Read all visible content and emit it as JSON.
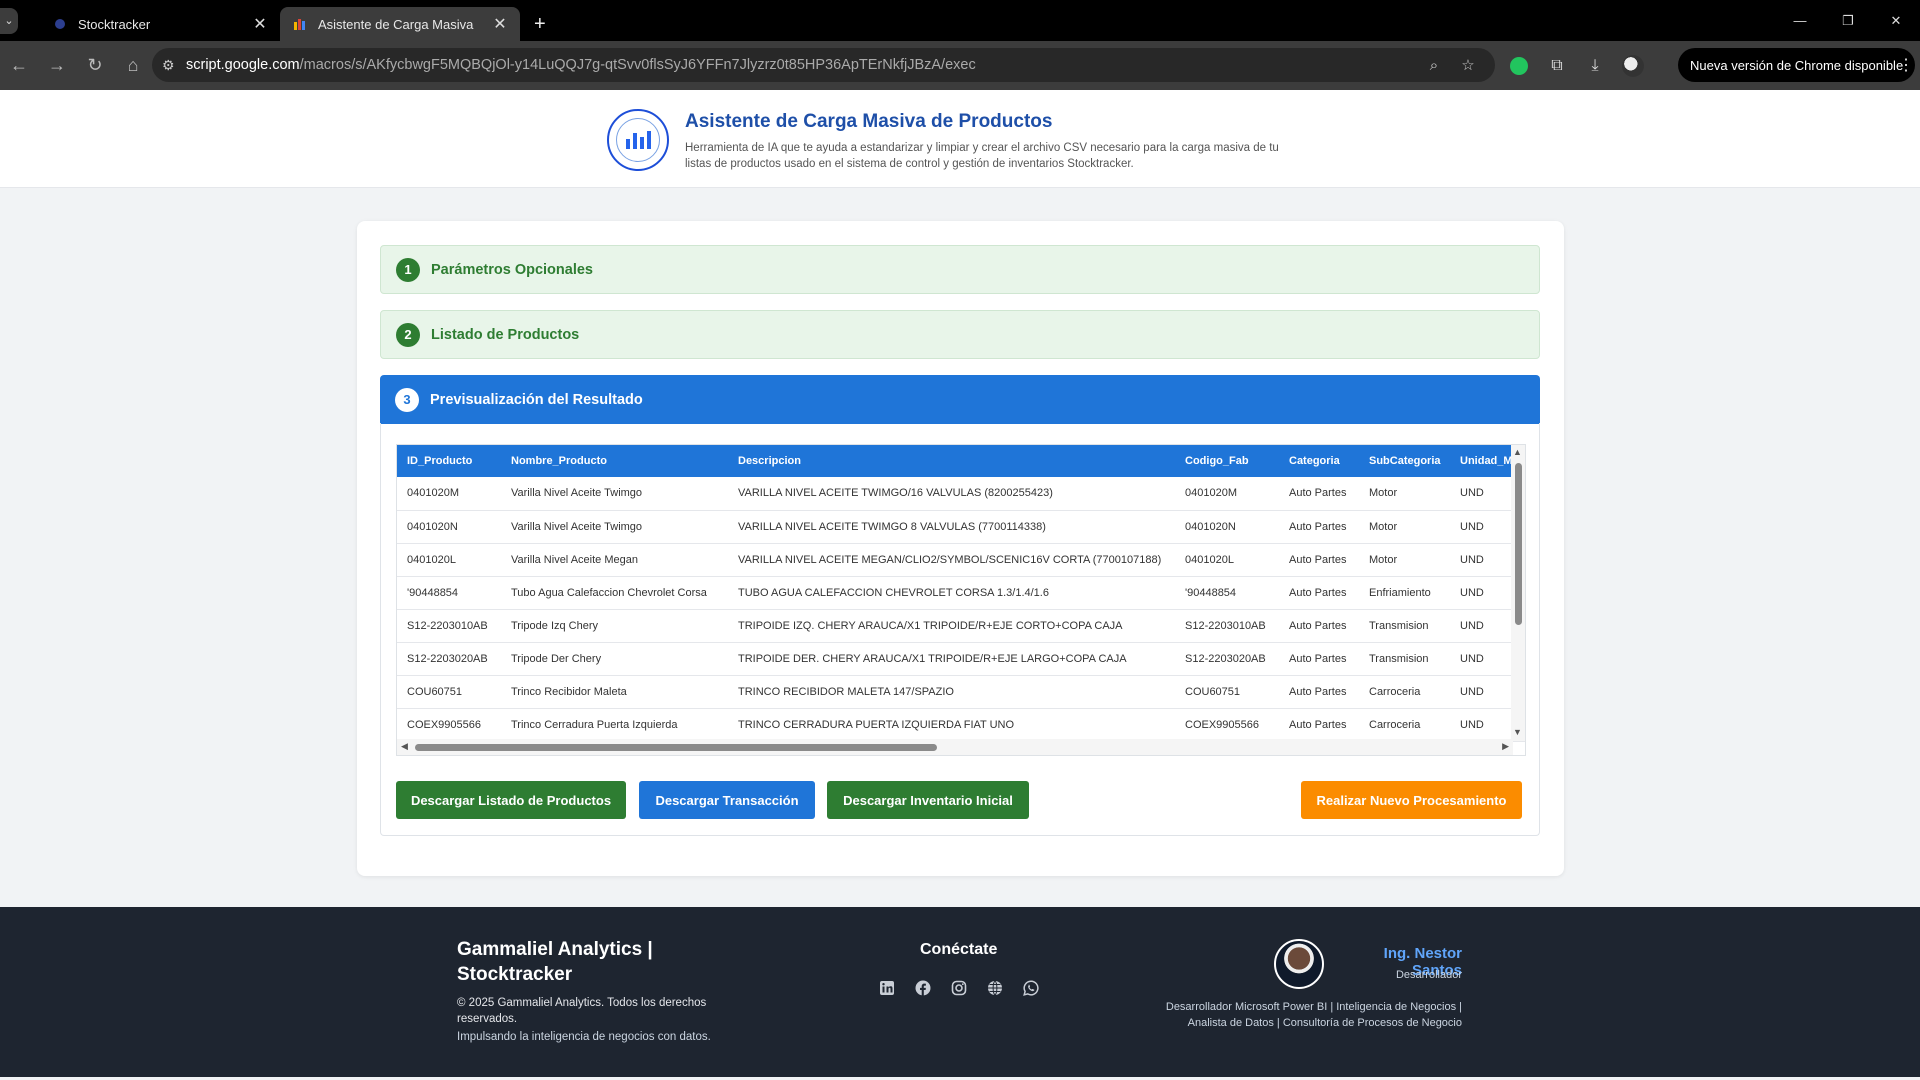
{
  "browser": {
    "tabs": [
      {
        "title": "Stocktracker"
      },
      {
        "title": "Asistente de Carga Masiva"
      }
    ],
    "url_host": "script.google.com",
    "url_path": "/macros/s/AKfycbwgF5MQBQjOl-y14LuQQJ7g-qtSvv0flsSyJ6YFFn7Jlyzrz0t85HP36ApTErNkfjJBzA/exec",
    "update_label": "Nueva versión de Chrome disponible"
  },
  "header": {
    "title": "Asistente de Carga Masiva de Productos",
    "subtitle": "Herramienta de IA que te ayuda a estandarizar y limpiar y crear el archivo CSV necesario para la carga masiva de tu listas de productos usado en el sistema de control y gestión de inventarios Stocktracker."
  },
  "steps": [
    {
      "num": "1",
      "label": "Parámetros Opcionales"
    },
    {
      "num": "2",
      "label": "Listado de Productos"
    },
    {
      "num": "3",
      "label": "Previsualización del Resultado"
    }
  ],
  "table": {
    "columns": [
      "ID_Producto",
      "Nombre_Producto",
      "Descripcion",
      "Codigo_Fab",
      "Categoria",
      "SubCategoria",
      "Unidad_Medida"
    ],
    "rows": [
      [
        "0401020M",
        "Varilla Nivel Aceite Twimgo",
        "VARILLA NIVEL ACEITE TWIMGO/16 VALVULAS (8200255423)",
        "0401020M",
        "Auto Partes",
        "Motor",
        "UND"
      ],
      [
        "0401020N",
        "Varilla Nivel Aceite Twimgo",
        "VARILLA NIVEL ACEITE TWIMGO 8 VALVULAS (7700114338)",
        "0401020N",
        "Auto Partes",
        "Motor",
        "UND"
      ],
      [
        "0401020L",
        "Varilla Nivel Aceite Megan",
        "VARILLA NIVEL ACEITE MEGAN/CLIO2/SYMBOL/SCENIC16V CORTA (7700107188)",
        "0401020L",
        "Auto Partes",
        "Motor",
        "UND"
      ],
      [
        "'90448854",
        "Tubo Agua Calefaccion Chevrolet Corsa",
        "TUBO AGUA CALEFACCION CHEVROLET CORSA 1.3/1.4/1.6",
        "'90448854",
        "Auto Partes",
        "Enfriamiento",
        "UND"
      ],
      [
        "S12-2203010AB",
        "Tripode Izq Chery",
        "TRIPOIDE IZQ. CHERY ARAUCA/X1 TRIPOIDE/R+EJE CORTO+COPA CAJA",
        "S12-2203010AB",
        "Auto Partes",
        "Transmision",
        "UND"
      ],
      [
        "S12-2203020AB",
        "Tripode Der Chery",
        "TRIPOIDE DER. CHERY ARAUCA/X1 TRIPOIDE/R+EJE LARGO+COPA CAJA",
        "S12-2203020AB",
        "Auto Partes",
        "Transmision",
        "UND"
      ],
      [
        "COU60751",
        "Trinco Recibidor Maleta",
        "TRINCO RECIBIDOR MALETA 147/SPAZIO",
        "COU60751",
        "Auto Partes",
        "Carroceria",
        "UND"
      ],
      [
        "COEX9905566",
        "Trinco Cerradura Puerta Izquierda",
        "TRINCO CERRADURA PUERTA IZQUIERDA FIAT UNO",
        "COEX9905566",
        "Auto Partes",
        "Carroceria",
        "UND"
      ]
    ]
  },
  "actions": {
    "download_products": "Descargar Listado de Productos",
    "download_transaction": "Descargar Transacción",
    "download_inventory": "Descargar Inventario Inicial",
    "new_process": "Realizar Nuevo Procesamiento"
  },
  "footer": {
    "brand": "Gammaliel Analytics | Stocktracker",
    "copyright": "© 2025 Gammaliel Analytics. Todos los derechos reservados.",
    "tagline": "Impulsando la inteligencia de negocios con datos.",
    "connect_title": "Conéctate",
    "social": [
      "linkedin-icon",
      "facebook-icon",
      "instagram-icon",
      "globe-icon",
      "whatsapp-icon"
    ],
    "dev_name": "Ing. Nestor Santos",
    "dev_role": "Desarrollador",
    "dev_desc": "Desarrollador Microsoft Power BI | Inteligencia de Negocios | Analista de Datos | Consultoría de Procesos de Negocio"
  },
  "colors": {
    "primary_blue": "#1f75d8",
    "success_green": "#2e7d32",
    "accent_orange": "#fb8c00",
    "footer_bg": "#1e2530"
  }
}
